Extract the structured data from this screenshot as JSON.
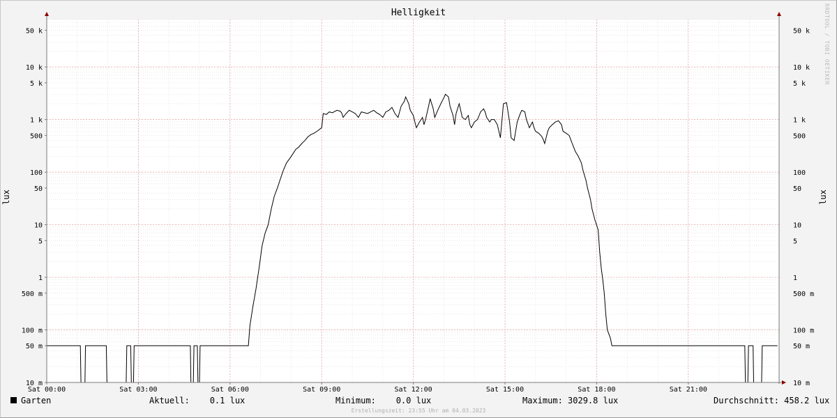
{
  "chart_data": {
    "type": "line",
    "title": "Helligkeit",
    "ylabel": "lux",
    "y_scale": "log",
    "ylim": [
      0.01,
      80000
    ],
    "y_ticks": [
      {
        "value": 50000,
        "label": "50 k"
      },
      {
        "value": 10000,
        "label": "10 k"
      },
      {
        "value": 5000,
        "label": "5 k"
      },
      {
        "value": 1000,
        "label": "1 k"
      },
      {
        "value": 500,
        "label": "500"
      },
      {
        "value": 100,
        "label": "100"
      },
      {
        "value": 50,
        "label": "50"
      },
      {
        "value": 10,
        "label": "10"
      },
      {
        "value": 5,
        "label": "5"
      },
      {
        "value": 1,
        "label": "1"
      },
      {
        "value": 0.5,
        "label": "500 m"
      },
      {
        "value": 0.1,
        "label": "100 m"
      },
      {
        "value": 0.05,
        "label": "50 m"
      },
      {
        "value": 0.01,
        "label": "10 m"
      }
    ],
    "xlim": [
      "Sat 00:00",
      "Sat 23:55"
    ],
    "x_ticks": [
      {
        "hour": 0,
        "label": "Sat 00:00"
      },
      {
        "hour": 3,
        "label": "Sat 03:00"
      },
      {
        "hour": 6,
        "label": "Sat 06:00"
      },
      {
        "hour": 9,
        "label": "Sat 09:00"
      },
      {
        "hour": 12,
        "label": "Sat 12:00"
      },
      {
        "hour": 15,
        "label": "Sat 15:00"
      },
      {
        "hour": 18,
        "label": "Sat 18:00"
      },
      {
        "hour": 21,
        "label": "Sat 21:00"
      }
    ],
    "grid": true,
    "series": [
      {
        "name": "Garten",
        "color": "#000000",
        "points": [
          [
            0.0,
            0.05
          ],
          [
            1.1,
            0.05
          ],
          [
            1.12,
            0.01
          ],
          [
            1.25,
            0.01
          ],
          [
            1.27,
            0.05
          ],
          [
            1.95,
            0.05
          ],
          [
            1.97,
            0.01
          ],
          [
            2.6,
            0.01
          ],
          [
            2.62,
            0.05
          ],
          [
            2.75,
            0.05
          ],
          [
            2.77,
            0.01
          ],
          [
            2.84,
            0.01
          ],
          [
            2.86,
            0.05
          ],
          [
            4.7,
            0.05
          ],
          [
            4.72,
            0.01
          ],
          [
            4.8,
            0.01
          ],
          [
            4.82,
            0.05
          ],
          [
            4.93,
            0.05
          ],
          [
            4.95,
            0.01
          ],
          [
            5.0,
            0.01
          ],
          [
            5.02,
            0.05
          ],
          [
            6.6,
            0.05
          ],
          [
            6.65,
            0.12
          ],
          [
            6.75,
            0.28
          ],
          [
            6.85,
            0.6
          ],
          [
            6.95,
            1.5
          ],
          [
            7.05,
            4
          ],
          [
            7.15,
            7
          ],
          [
            7.25,
            10
          ],
          [
            7.35,
            20
          ],
          [
            7.45,
            35
          ],
          [
            7.55,
            50
          ],
          [
            7.65,
            75
          ],
          [
            7.75,
            110
          ],
          [
            7.85,
            150
          ],
          [
            7.95,
            180
          ],
          [
            8.05,
            220
          ],
          [
            8.15,
            270
          ],
          [
            8.25,
            300
          ],
          [
            8.35,
            350
          ],
          [
            8.45,
            400
          ],
          [
            8.55,
            470
          ],
          [
            8.65,
            520
          ],
          [
            8.75,
            550
          ],
          [
            8.85,
            600
          ],
          [
            9.0,
            700
          ],
          [
            9.05,
            1300
          ],
          [
            9.15,
            1250
          ],
          [
            9.25,
            1400
          ],
          [
            9.35,
            1350
          ],
          [
            9.5,
            1500
          ],
          [
            9.6,
            1450
          ],
          [
            9.65,
            1350
          ],
          [
            9.7,
            1100
          ],
          [
            9.8,
            1300
          ],
          [
            9.9,
            1500
          ],
          [
            10.0,
            1400
          ],
          [
            10.1,
            1300
          ],
          [
            10.2,
            1100
          ],
          [
            10.3,
            1400
          ],
          [
            10.5,
            1300
          ],
          [
            10.7,
            1500
          ],
          [
            10.8,
            1350
          ],
          [
            10.9,
            1250
          ],
          [
            11.0,
            1100
          ],
          [
            11.1,
            1400
          ],
          [
            11.2,
            1500
          ],
          [
            11.3,
            1700
          ],
          [
            11.4,
            1300
          ],
          [
            11.5,
            1100
          ],
          [
            11.6,
            1800
          ],
          [
            11.7,
            2200
          ],
          [
            11.75,
            2700
          ],
          [
            11.85,
            2000
          ],
          [
            11.9,
            1500
          ],
          [
            12.0,
            1200
          ],
          [
            12.05,
            900
          ],
          [
            12.1,
            700
          ],
          [
            12.2,
            900
          ],
          [
            12.3,
            1100
          ],
          [
            12.35,
            800
          ],
          [
            12.4,
            1000
          ],
          [
            12.5,
            1800
          ],
          [
            12.55,
            2500
          ],
          [
            12.65,
            1600
          ],
          [
            12.7,
            1100
          ],
          [
            12.8,
            1500
          ],
          [
            12.9,
            2000
          ],
          [
            13.0,
            2600
          ],
          [
            13.05,
            3029.8
          ],
          [
            13.15,
            2700
          ],
          [
            13.2,
            1800
          ],
          [
            13.3,
            1200
          ],
          [
            13.35,
            800
          ],
          [
            13.4,
            1300
          ],
          [
            13.5,
            2000
          ],
          [
            13.55,
            1500
          ],
          [
            13.6,
            1100
          ],
          [
            13.7,
            1000
          ],
          [
            13.8,
            1200
          ],
          [
            13.85,
            800
          ],
          [
            13.9,
            700
          ],
          [
            14.0,
            900
          ],
          [
            14.1,
            1000
          ],
          [
            14.2,
            1400
          ],
          [
            14.3,
            1600
          ],
          [
            14.35,
            1400
          ],
          [
            14.4,
            1100
          ],
          [
            14.5,
            900
          ],
          [
            14.55,
            1000
          ],
          [
            14.65,
            1000
          ],
          [
            14.75,
            800
          ],
          [
            14.85,
            450
          ],
          [
            14.95,
            2000
          ],
          [
            15.05,
            2100
          ],
          [
            15.15,
            900
          ],
          [
            15.2,
            450
          ],
          [
            15.3,
            400
          ],
          [
            15.4,
            900
          ],
          [
            15.5,
            1300
          ],
          [
            15.55,
            1500
          ],
          [
            15.65,
            1400
          ],
          [
            15.7,
            1000
          ],
          [
            15.8,
            700
          ],
          [
            15.9,
            900
          ],
          [
            15.95,
            700
          ],
          [
            16.0,
            600
          ],
          [
            16.1,
            550
          ],
          [
            16.2,
            480
          ],
          [
            16.25,
            420
          ],
          [
            16.3,
            350
          ],
          [
            16.4,
            600
          ],
          [
            16.45,
            700
          ],
          [
            16.55,
            800
          ],
          [
            16.65,
            900
          ],
          [
            16.75,
            950
          ],
          [
            16.85,
            800
          ],
          [
            16.9,
            600
          ],
          [
            17.0,
            550
          ],
          [
            17.1,
            500
          ],
          [
            17.2,
            350
          ],
          [
            17.3,
            250
          ],
          [
            17.4,
            200
          ],
          [
            17.5,
            150
          ],
          [
            17.55,
            110
          ],
          [
            17.65,
            70
          ],
          [
            17.7,
            50
          ],
          [
            17.8,
            30
          ],
          [
            17.85,
            20
          ],
          [
            17.95,
            12
          ],
          [
            18.05,
            8
          ],
          [
            18.1,
            3
          ],
          [
            18.15,
            1.5
          ],
          [
            18.2,
            0.9
          ],
          [
            18.25,
            0.5
          ],
          [
            18.3,
            0.2
          ],
          [
            18.35,
            0.1
          ],
          [
            18.45,
            0.07
          ],
          [
            18.5,
            0.05
          ],
          [
            22.85,
            0.05
          ],
          [
            22.87,
            0.01
          ],
          [
            22.95,
            0.01
          ],
          [
            22.97,
            0.05
          ],
          [
            23.12,
            0.05
          ],
          [
            23.14,
            0.01
          ],
          [
            23.4,
            0.01
          ],
          [
            23.42,
            0.05
          ],
          [
            23.92,
            0.05
          ]
        ]
      }
    ],
    "legend": {
      "position": "bottom",
      "series_label": "Garten",
      "current": "Aktuell:    0.1 lux",
      "minimum": "Minimum:    0.0 lux",
      "maximum": "Maximum: 3029.8 lux",
      "average": "Durchschnitt: 458.2 lux"
    }
  },
  "watermark": "RRDTOOL / TOBI OETIKER",
  "footer": "Erstellungszeit: 23:55 Uhr am 04.03.2023",
  "colors": {
    "background": "#f3f3f3",
    "plot_background": "#ffffff",
    "major_grid": "#e8a0a0",
    "minor_grid": "#d8d8d8",
    "axis": "#8b0000",
    "line": "#000000"
  }
}
